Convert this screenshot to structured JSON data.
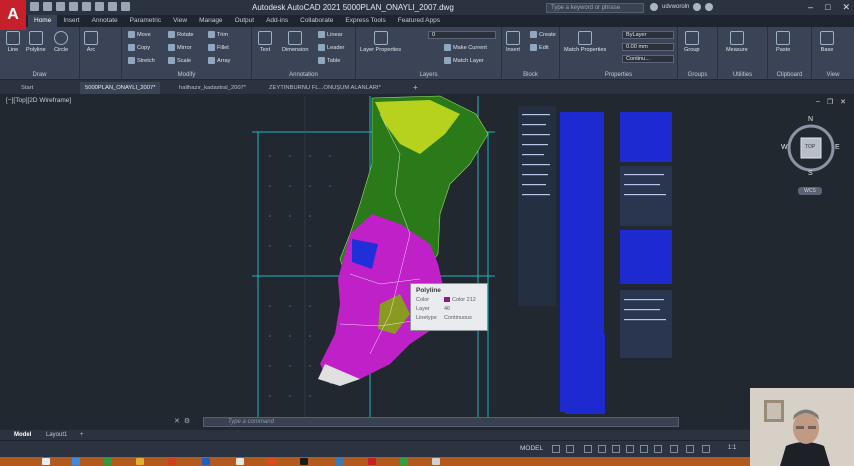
{
  "app": {
    "logo_letter": "A",
    "title": "Autodesk AutoCAD 2021   5000PLAN_ONAYLI_2007.dwg",
    "search_placeholder": "Type a keyword or phrase",
    "username": "udvworoln"
  },
  "ribbon_tabs": [
    "Home",
    "Insert",
    "Annotate",
    "Parametric",
    "View",
    "Manage",
    "Output",
    "Add-ins",
    "Collaborate",
    "Express Tools",
    "Featured Apps"
  ],
  "active_ribbon_tab": "Home",
  "panels": {
    "draw": {
      "title": "Draw",
      "tools": [
        "Line",
        "Polyline",
        "Circle",
        "Arc"
      ]
    },
    "modify": {
      "title": "Modify",
      "tools": [
        "Move",
        "Rotate",
        "Trim",
        "Copy",
        "Mirror",
        "Fillet",
        "Stretch",
        "Scale",
        "Array"
      ]
    },
    "annotation": {
      "title": "Annotation",
      "tools": [
        "Text",
        "Dimension",
        "Linear",
        "Leader",
        "Table"
      ]
    },
    "layers": {
      "title": "Layers",
      "big": "Layer Properties",
      "current": "0",
      "tools": [
        "Make Current",
        "Match Layer"
      ]
    },
    "block": {
      "title": "Block",
      "tools": [
        "Insert",
        "Create",
        "Edit"
      ]
    },
    "properties": {
      "title": "Properties",
      "big": "Match Properties",
      "color": "ByLayer",
      "lineweight": "0.00 mm",
      "linetype": "Continu..."
    },
    "groups": {
      "title": "Groups",
      "tool": "Group"
    },
    "utilities": {
      "title": "Utilities",
      "tool": "Measure"
    },
    "clipboard": {
      "title": "Clipboard",
      "tool": "Paste"
    },
    "view": {
      "title": "View",
      "tool": "Base"
    }
  },
  "file_tabs": [
    "Start",
    "5000PLAN_ONAYLI_2007*",
    "halihazır_kadastral_2007*",
    "ZEYTINBURNU FL...ONUŞUM ALANLARI*"
  ],
  "active_file_tab": "5000PLAN_ONAYLI_2007*",
  "viewport_label": "[−][Top][2D Wireframe]",
  "viewcube": {
    "n": "N",
    "s": "S",
    "e": "E",
    "w": "W",
    "top": "TOP",
    "wcs": "WCS"
  },
  "tooltip": {
    "title": "Polyline",
    "rows": [
      {
        "key": "Color",
        "value": "Color 212"
      },
      {
        "key": "Layer",
        "value": "46"
      },
      {
        "key": "Linetype",
        "value": "Continuous"
      }
    ],
    "swatch_color": "#8b1a8b"
  },
  "command_placeholder": "Type a command",
  "layout_tabs": [
    "Model",
    "Layout1"
  ],
  "status": {
    "model": "MODEL",
    "scale": "1:1"
  },
  "colors": {
    "ribbon_bg": "#3b4456",
    "canvas_bg": "#212830",
    "taskbar": "#b35a1f",
    "accent_red": "#c8202a"
  }
}
